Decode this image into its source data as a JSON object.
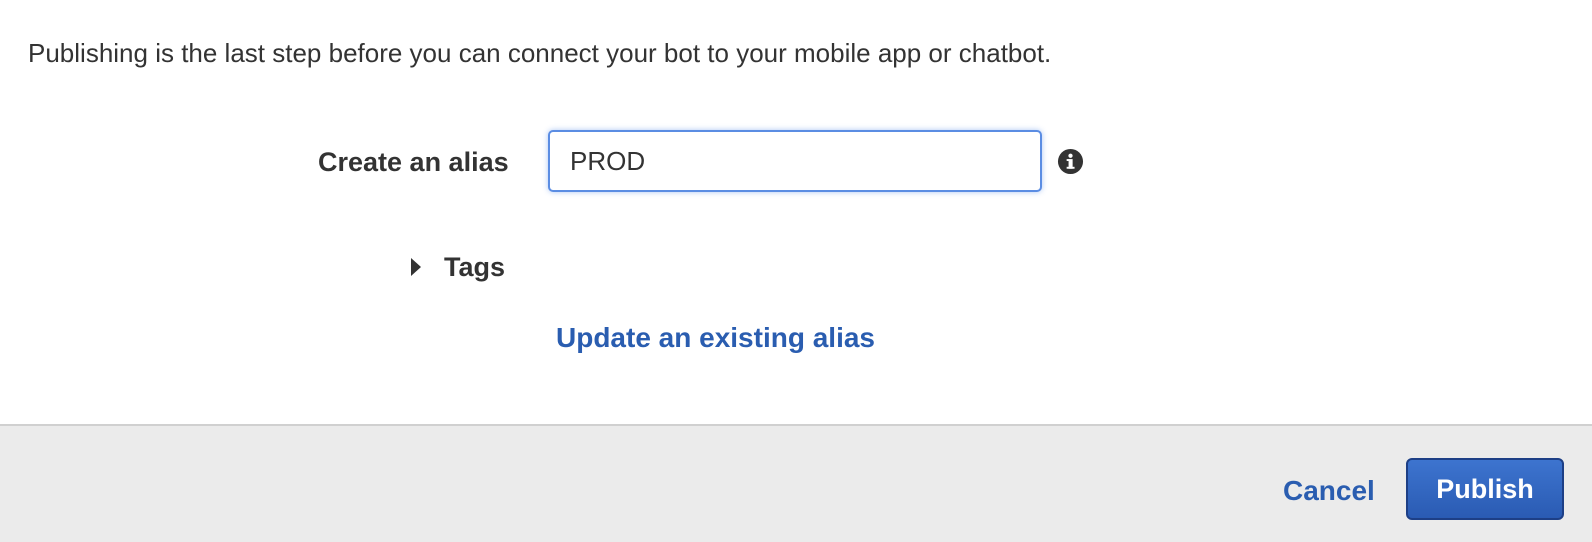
{
  "intro": {
    "text": "Publishing is the last step before you can connect your bot to your mobile app or chatbot."
  },
  "alias": {
    "label": "Create an alias",
    "value": "PROD",
    "info_icon": "info-circle-icon"
  },
  "tags": {
    "label": "Tags",
    "expanded": false,
    "toggle_icon": "caret-right-icon"
  },
  "links": {
    "update_alias": "Update an existing alias"
  },
  "footer": {
    "cancel_label": "Cancel",
    "publish_label": "Publish"
  },
  "colors": {
    "link": "#2a5db0",
    "primary_button": "#2f62bd",
    "footer_bg": "#ebebeb",
    "input_focus_border": "#5b8de3"
  }
}
